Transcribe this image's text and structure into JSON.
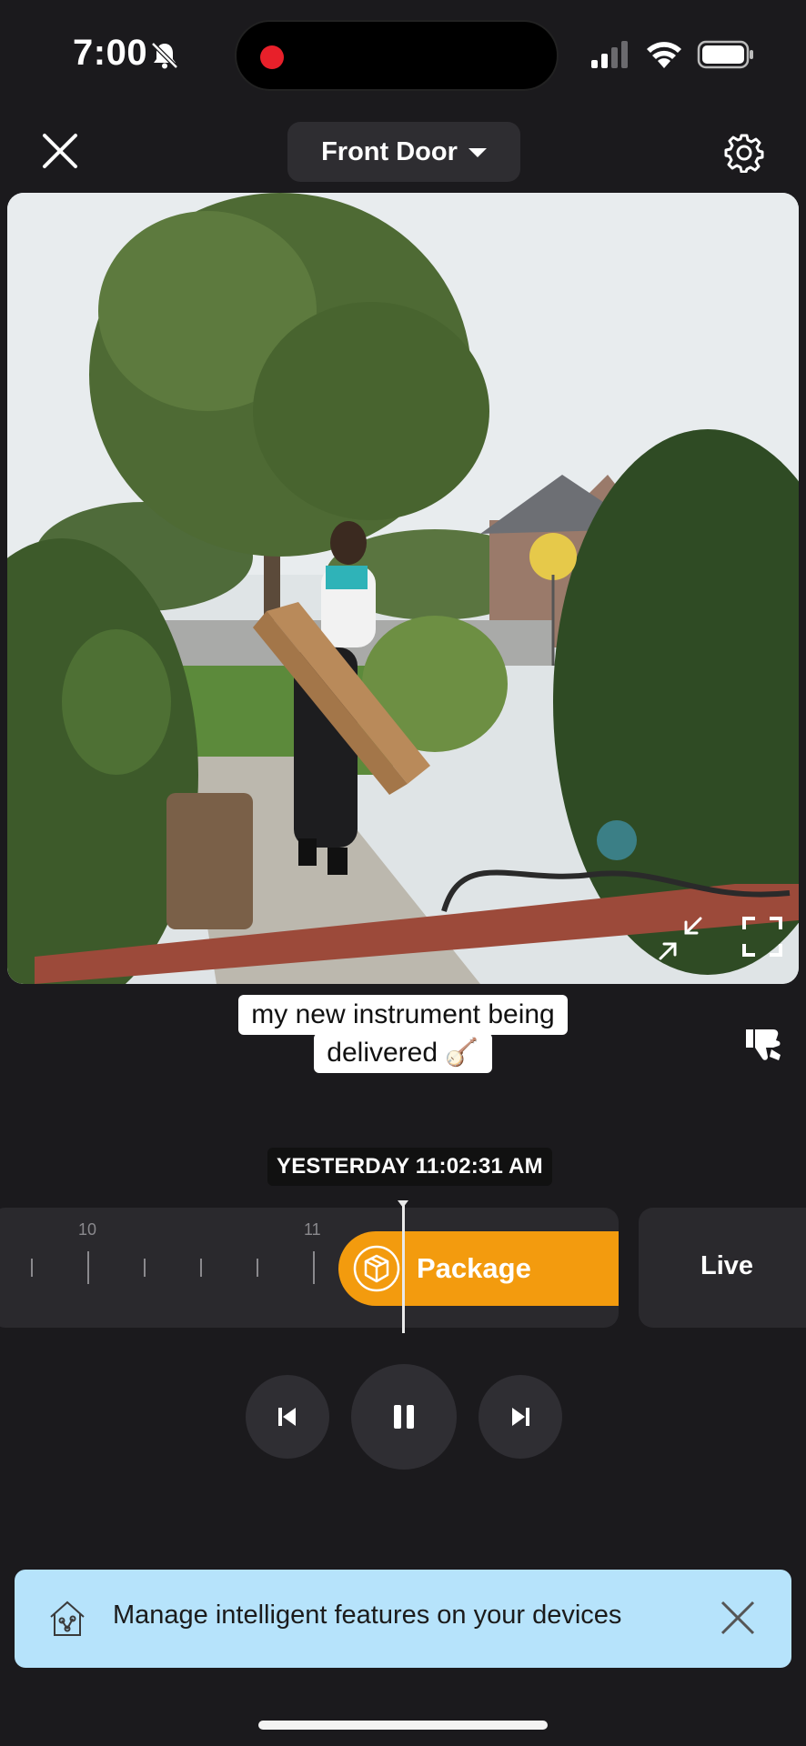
{
  "status_bar": {
    "time": "7:00",
    "icons": [
      "bell-muted-icon",
      "signal-icon",
      "wifi-icon",
      "battery-icon"
    ],
    "recording_indicator_color": "#e8202a"
  },
  "header": {
    "camera_name": "Front Door",
    "close_icon": "close-icon",
    "settings_icon": "gear-icon"
  },
  "caption": {
    "line1": "my new instrument being",
    "line2": "delivered 🪕"
  },
  "timestamp": "YESTERDAY 11:02:31 AM",
  "timeline": {
    "tick_labels": [
      "10",
      "11"
    ],
    "event": {
      "label": "Package",
      "icon": "package-icon",
      "color": "#f39b0e"
    },
    "live_label": "Live"
  },
  "playback": {
    "prev_icon": "skip-previous-icon",
    "pause_icon": "pause-icon",
    "next_icon": "skip-next-icon"
  },
  "banner": {
    "text": "Manage intelligent features on your devices",
    "icon": "smart-home-icon",
    "color": "#b6e3fb"
  }
}
